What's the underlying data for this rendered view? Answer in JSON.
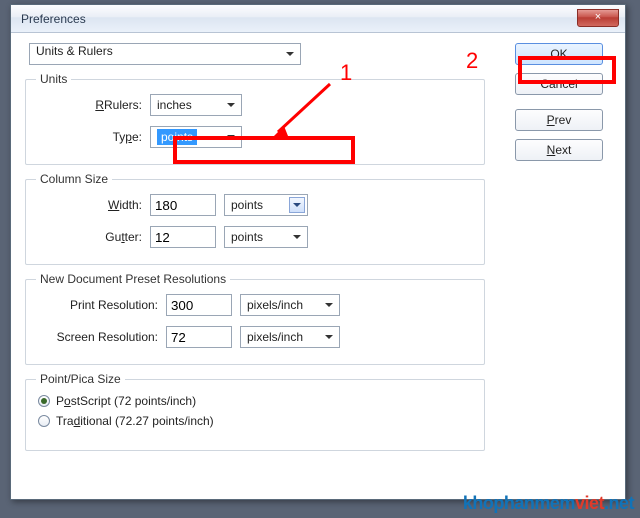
{
  "window": {
    "title": "Preferences",
    "close": "×"
  },
  "category": "Units & Rulers",
  "units": {
    "legend": "Units",
    "rulers_label": "Rulers:",
    "rulers_value": "inches",
    "type_label": "Type:",
    "type_value": "points"
  },
  "column": {
    "legend": "Column Size",
    "width_label": "Width:",
    "width_value": "180",
    "width_unit": "points",
    "gutter_label": "Gutter:",
    "gutter_value": "12",
    "gutter_unit": "points"
  },
  "resolutions": {
    "legend": "New Document Preset Resolutions",
    "print_label": "Print Resolution:",
    "print_value": "300",
    "print_unit": "pixels/inch",
    "screen_label": "Screen Resolution:",
    "screen_value": "72",
    "screen_unit": "pixels/inch"
  },
  "pointpica": {
    "legend": "Point/Pica Size",
    "postscript": "PostScript (72 points/inch)",
    "traditional": "Traditional (72.27 points/inch)"
  },
  "buttons": {
    "ok": "OK",
    "cancel": "Cancel",
    "prev": "Prev",
    "next": "Next"
  },
  "annotations": {
    "one": "1",
    "two": "2"
  },
  "watermark": {
    "a": "khophanmem",
    "b": "viet",
    "c": ".net"
  },
  "colors": {
    "highlight_bg": "#3399ff",
    "highlight_fg": "#ffffff",
    "red": "#f00"
  }
}
